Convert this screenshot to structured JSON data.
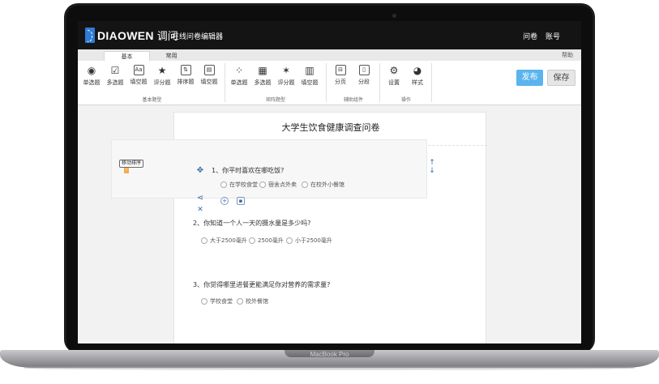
{
  "device": {
    "label": "MacBook Pro"
  },
  "app": {
    "logo_text": "DIAOWEN",
    "logo_cn": "调问",
    "editor_title": "在线问卷编辑器",
    "top_links": [
      "问卷",
      "账号"
    ]
  },
  "ribbon_tabs": [
    {
      "label": "基本"
    },
    {
      "label": "常用"
    }
  ],
  "help_label": "帮助",
  "toolbar": {
    "basic": [
      {
        "label": "单选题",
        "icon": "radio-icon",
        "glyph": "◉"
      },
      {
        "label": "多选题",
        "icon": "checkbox-icon",
        "glyph": "☑"
      },
      {
        "label": "填空题",
        "icon": "textbox-icon",
        "glyph": "Aa"
      },
      {
        "label": "评分题",
        "icon": "star-icon",
        "glyph": "★"
      },
      {
        "label": "排序题",
        "icon": "sort-icon",
        "glyph": "⇅"
      },
      {
        "label": "填空题",
        "icon": "multi-fill-icon",
        "glyph": "▤"
      }
    ],
    "matrix": [
      {
        "label": "单选题",
        "icon": "matrix-radio-icon",
        "glyph": "⁘"
      },
      {
        "label": "多选题",
        "icon": "matrix-checkbox-icon",
        "glyph": "▦"
      },
      {
        "label": "评分题",
        "icon": "matrix-star-icon",
        "glyph": "✶"
      },
      {
        "label": "填空题",
        "icon": "matrix-fill-icon",
        "glyph": "▥"
      }
    ],
    "aux": [
      {
        "label": "分页",
        "icon": "page-break-icon",
        "glyph": "⊟"
      },
      {
        "label": "分段",
        "icon": "section-icon",
        "glyph": "▯"
      }
    ],
    "ops": [
      {
        "label": "设置",
        "icon": "settings-icon",
        "glyph": "⚙"
      },
      {
        "label": "样式",
        "icon": "palette-icon",
        "glyph": "◕"
      }
    ],
    "groups": [
      "基本题型",
      "矩阵题型",
      "辅助组件",
      "操作"
    ]
  },
  "actions": {
    "publish": "发布",
    "save": "保存"
  },
  "survey": {
    "title": "大学生饮食健康调查问卷",
    "drag_tag": "移动排序",
    "questions": [
      {
        "text": "1、你平时喜欢在哪吃饭?",
        "options": [
          "在学校食堂",
          "宿舍点外卖",
          "在校外小餐馆"
        ]
      },
      {
        "text": "2、你知道一个人一天的摄水量是多少吗?",
        "options": [
          "大于2500毫升",
          "2500毫升",
          "小于2500毫升"
        ]
      },
      {
        "text": "3、你觉得哪里进餐更能满足你对营养的需求量?",
        "options": [
          "学校食堂",
          "校外餐馆"
        ]
      }
    ]
  }
}
